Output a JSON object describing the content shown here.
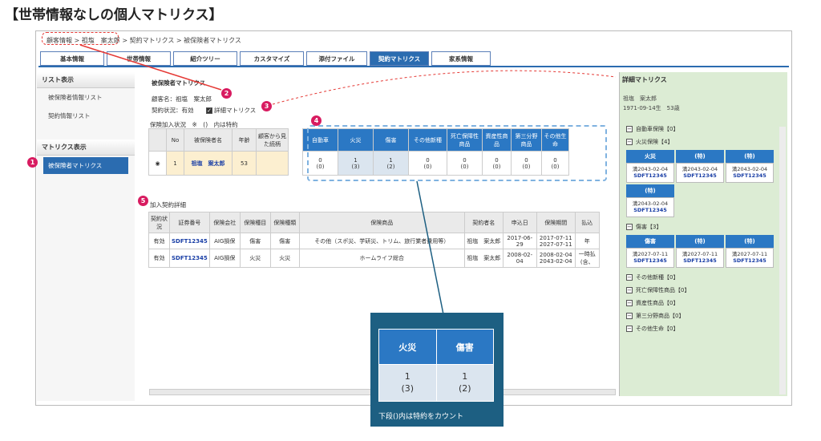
{
  "title": "【世帯情報なしの個人マトリクス】",
  "breadcrumb": "顧客情報 > 祖塩　案太郎 > 契約マトリクス > 被保険者マトリクス",
  "tabs": [
    "基本情報",
    "世帯情報",
    "紹介ツリー",
    "カスタマイズ",
    "添付ファイル",
    "契約マトリクス",
    "家系情報"
  ],
  "sidebar": {
    "list_head": "リスト表示",
    "list_items": [
      "被保険者情報リスト",
      "契約情報リスト"
    ],
    "matrix_head": "マトリクス表示",
    "matrix_items": [
      "被保険者マトリクス"
    ]
  },
  "main": {
    "heading": "被保険者マトリクス",
    "customer": "顧客名：祖塩　案太郎",
    "status": "契約状況：有効",
    "detail_check": "詳細マトリクス",
    "legend": "保険加入状況　※　()　内は特約",
    "t1_headers": [
      "No",
      "被保険者名",
      "年齢",
      "顧客から見た続柄"
    ],
    "t1_row": {
      "no": "1",
      "name": "祖塩　案太郎",
      "age": "53",
      "rel": ""
    },
    "matrix_headers": [
      "自動車",
      "火災",
      "傷害",
      "その他新種",
      "死亡保障性商品",
      "資産性商品",
      "第三分野商品",
      "その他生命"
    ],
    "matrix_values": [
      "0",
      "1",
      "1",
      "0",
      "0",
      "0",
      "0",
      "0"
    ],
    "matrix_sub": [
      "(0)",
      "(3)",
      "(2)",
      "(0)",
      "(0)",
      "(0)",
      "(0)",
      "(0)"
    ],
    "sec2": "加入契約詳細",
    "t2_headers": [
      "契約状況",
      "証券番号",
      "保険会社",
      "保険種目",
      "保険種類",
      "保険商品",
      "契約者名",
      "申込日",
      "保険期間",
      "払込"
    ],
    "t2_rows": [
      [
        "有効",
        "SDFT12345",
        "AIG損保",
        "傷害",
        "傷害",
        "その他（スポ災、学研災、トリム、旅行業者費用等）",
        "祖塩　案太郎",
        "2017-06-29",
        "2017-07-11",
        "2027-07-11",
        "年"
      ],
      [
        "有効",
        "SDFT12345",
        "AIG損保",
        "火災",
        "火災",
        "ホームライフ総合",
        "祖塩　案太郎",
        "2008-02-04",
        "2008-02-04",
        "2043-02-04",
        "一時払(含、"
      ]
    ]
  },
  "badges": [
    "1",
    "2",
    "3",
    "4",
    "5"
  ],
  "detail": {
    "heading": "詳細マトリクス",
    "name": "祖塩　案太郎",
    "birth": "1971-09-14生　53歳",
    "auto": "自動車保険【0】",
    "fire": "火災保険【4】",
    "fire_heads": [
      "火災",
      "(特)",
      "(特)",
      "(特)"
    ],
    "fire_cards": [
      [
        "満2043-02-04",
        "SDFT12345"
      ],
      [
        "満2043-02-04",
        "SDFT12345"
      ],
      [
        "満2043-02-04",
        "SDFT12345"
      ],
      [
        "満2043-02-04",
        "SDFT12345"
      ]
    ],
    "inj": "傷害【3】",
    "inj_heads": [
      "傷害",
      "(特)",
      "(特)"
    ],
    "inj_cards": [
      [
        "満2027-07-11",
        "SDFT12345"
      ],
      [
        "満2027-07-11",
        "SDFT12345"
      ],
      [
        "満2027-07-11",
        "SDFT12345"
      ]
    ],
    "others": [
      "その他新種【0】",
      "死亡保障性商品【0】",
      "資産性商品【0】",
      "第三分野商品【0】",
      "その他生命【0】"
    ]
  },
  "zoom": {
    "heads": [
      "火災",
      "傷害"
    ],
    "vals": [
      "1",
      "1"
    ],
    "subs": [
      "(3)",
      "(2)"
    ],
    "caption": "下段()内は特約をカウント"
  },
  "colors": {
    "primary": "#2b6cb0",
    "header_blue": "#2b78c4",
    "badge": "#d81b60",
    "detail_bg": "#dcecd4"
  }
}
